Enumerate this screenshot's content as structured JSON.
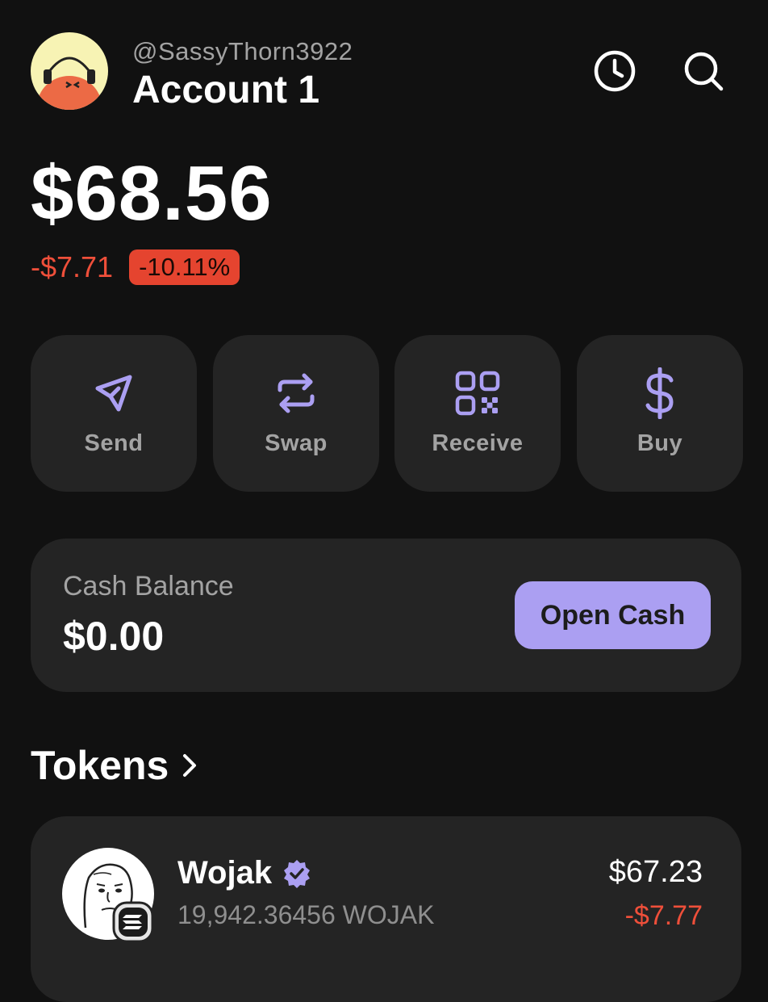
{
  "header": {
    "username": "@SassyThorn3922",
    "account_name": "Account 1",
    "icons": [
      "history-icon",
      "search-icon"
    ]
  },
  "balance": {
    "total": "$68.56",
    "change_amount": "-$7.71",
    "change_percent": "-10.11%"
  },
  "actions": [
    {
      "label": "Send",
      "icon": "send-icon"
    },
    {
      "label": "Swap",
      "icon": "swap-icon"
    },
    {
      "label": "Receive",
      "icon": "qr-code-icon"
    },
    {
      "label": "Buy",
      "icon": "dollar-icon"
    }
  ],
  "cash": {
    "label": "Cash Balance",
    "value": "$0.00",
    "button_label": "Open Cash"
  },
  "tokens": {
    "title": "Tokens",
    "items": [
      {
        "name": "Wojak",
        "verified": true,
        "amount": "19,942.36456 WOJAK",
        "value": "$67.23",
        "change": "-$7.77"
      }
    ]
  },
  "colors": {
    "background": "#111111",
    "card": "#242424",
    "accent": "#ab9ff2",
    "negative": "#ef4f3a",
    "muted_text": "#a3a3a3"
  }
}
